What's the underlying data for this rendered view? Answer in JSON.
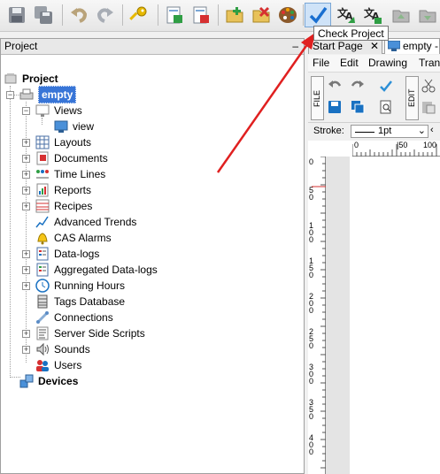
{
  "tooltip": "Check Project",
  "toolbar": {
    "icons": [
      "save-icon",
      "save-all-icon",
      "undo-icon",
      "redo-icon",
      "key-icon",
      "import-icon",
      "export-icon",
      "add-file-icon",
      "remove-file-icon",
      "palette-icon",
      "check-icon",
      "translate-icon",
      "translate-edit-icon",
      "folder-up-icon",
      "folder-down-icon"
    ]
  },
  "panel": {
    "title": "Project",
    "minimize": "–"
  },
  "tree": {
    "root": "Project",
    "project": "empty",
    "views": "Views",
    "view": "view",
    "items": [
      "Layouts",
      "Documents",
      "Time Lines",
      "Reports",
      "Recipes",
      "Advanced Trends",
      "CAS Alarms",
      "Data-logs",
      "Aggregated Data-logs",
      "Running Hours",
      "Tags Database",
      "Connections",
      "Server Side Scripts",
      "Sounds",
      "Users"
    ],
    "devices": "Devices"
  },
  "editor": {
    "tabs": [
      "Start Page",
      "empty -"
    ],
    "menus": [
      "File",
      "Edit",
      "Drawing",
      "Tran"
    ],
    "ribbon_file": "FILE",
    "ribbon_edit": "EDIT",
    "stroke_label": "Stroke:",
    "stroke_value": "1pt",
    "hruler_ticks": [
      "0",
      "|50",
      "100"
    ],
    "vruler_ticks": [
      "0",
      "5 0",
      "1 0 0",
      "1 5 0",
      "2 0 0",
      "2 5 0",
      "3 0 0",
      "3 5 0",
      "4 0 0"
    ]
  },
  "colors": {
    "selection": "#3875d7",
    "arrow": "#e02020",
    "check": "#1a6fd0"
  }
}
